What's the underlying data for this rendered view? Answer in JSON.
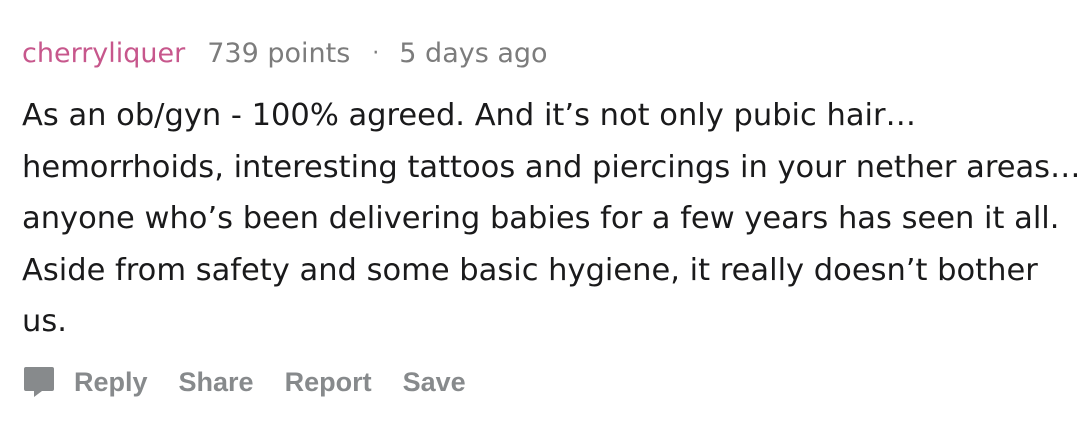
{
  "comment": {
    "username": "cherryliquer",
    "points": "739 points",
    "separator": "·",
    "timestamp": "5 days ago",
    "body": "As an ob/gyn - 100% agreed. And it’s not only pubic hair… hemorrhoids, interesting tattoos and piercings in your nether areas… anyone who’s been delivering babies for a few years has seen it all. Aside from safety and some basic hygiene, it really doesn’t bother us."
  },
  "actions": {
    "reply_icon": "speech-bubble-icon",
    "reply_label": "Reply",
    "share_label": "Share",
    "report_label": "Report",
    "save_label": "Save"
  },
  "colors": {
    "username": "#c7578c",
    "meta": "#7c7c7c",
    "body_text": "#1a1a1b",
    "action_text": "#878a8c",
    "background": "#ffffff"
  }
}
